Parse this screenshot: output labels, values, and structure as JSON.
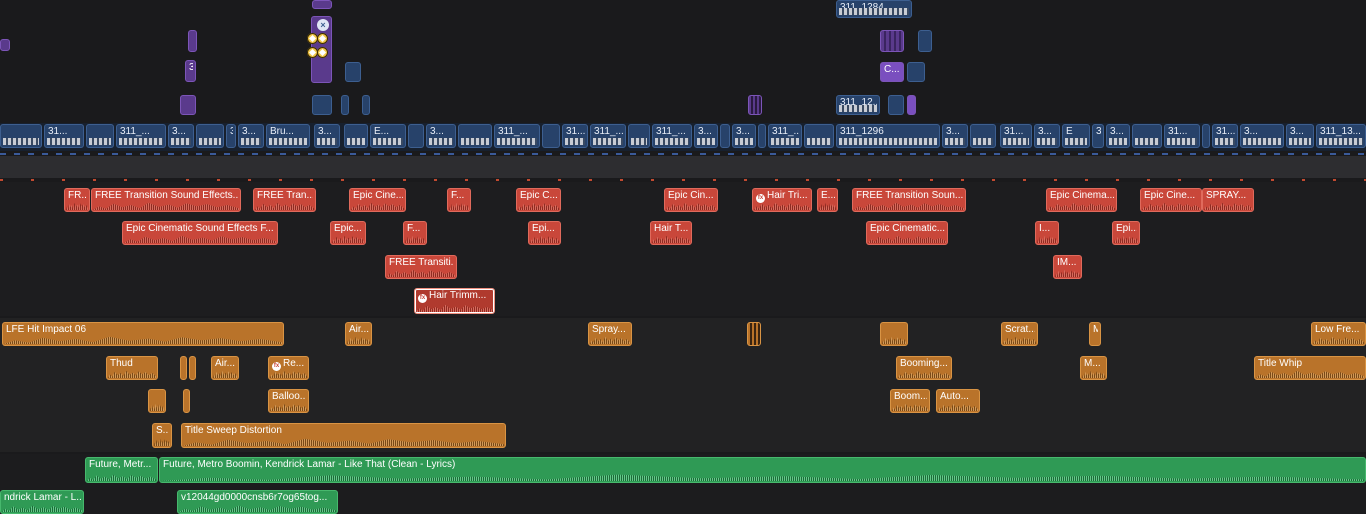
{
  "colors": {
    "background": "#1a1a1c",
    "sound_effects": "#c9473a",
    "ambience": "#b9732a",
    "music": "#2f9a55",
    "video": "#27426a",
    "connected_title": "#5a3a8c"
  },
  "video_upper": {
    "clip_a": "311_1284",
    "clip_b": "311_12...",
    "clip_c": "C...",
    "clip_d": "3",
    "close_icon": "×"
  },
  "primary_storyline": {
    "clips": [
      "31...",
      "311_...",
      "3...",
      "3",
      "3...",
      "Bru...",
      "3...",
      "E...",
      "3...",
      "311_...",
      "31...",
      "311_...",
      "311_...",
      "3...",
      "3...",
      "311_...",
      "311_1296",
      "3...",
      "31...",
      "3...",
      "E",
      "3",
      "3...",
      "31...",
      "3...",
      "31...",
      "3...",
      "311_13..."
    ]
  },
  "sfx_lane_1": [
    "FR...",
    "FREE Transition Sound Effects...",
    "FREE Tran...",
    "Epic Cine...",
    "F...",
    "Epic C...",
    "Epic Cin...",
    "Hair Tri...",
    "E...",
    "FREE Transition Soun...",
    "Epic Cinema...",
    "Epic Cine...",
    "SPRAY..."
  ],
  "sfx_lane_2": [
    "Epic Cinematic Sound Effects  F...",
    "Epic...",
    "F...",
    "Epi...",
    "Hair T...",
    "Epic Cinematic...",
    "I...",
    "Epi..."
  ],
  "sfx_lane_3": [
    "FREE Transiti...",
    "IM..."
  ],
  "sfx_lane_4": [
    "Hair Trimm..."
  ],
  "amb_lane_1": [
    "LFE Hit Impact 06",
    "Air...",
    "Spray...",
    "Scrat...",
    "M",
    "Low Fre..."
  ],
  "amb_lane_2": [
    "Thud",
    "Air...",
    "Re...",
    "Booming...",
    "M...",
    "Title Whip"
  ],
  "amb_lane_3": [
    "Balloo...",
    "Boom...",
    "Auto..."
  ],
  "amb_lane_4": [
    "S...",
    "Title Sweep Distortion"
  ],
  "music_lane_1": [
    "Future, Metr...",
    "Future, Metro Boomin, Kendrick Lamar - Like That (Clean - Lyrics)"
  ],
  "music_lane_2": [
    "ndrick Lamar - L...",
    "v12044gd0000cnsb6r7og65tog..."
  ]
}
